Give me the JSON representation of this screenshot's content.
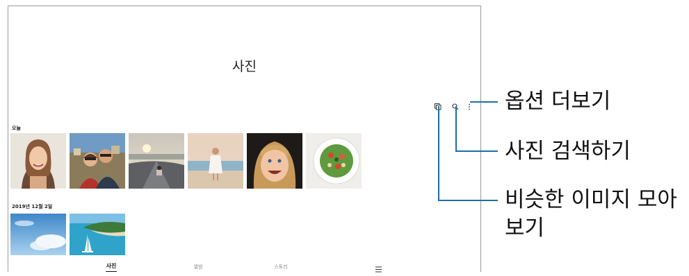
{
  "header": {
    "title": "사진"
  },
  "toolbar": {
    "similar_icon": "stack-icon",
    "search_icon": "search-icon",
    "more_icon": "more-vert-icon"
  },
  "sections": [
    {
      "label": "오늘"
    },
    {
      "label": "2019년 12월 2일"
    }
  ],
  "bottom_nav": {
    "items": [
      {
        "label": "사진",
        "active": true
      },
      {
        "label": "앨범",
        "active": false
      },
      {
        "label": "스토리",
        "active": false
      }
    ],
    "menu_icon": "hamburger-menu-icon"
  },
  "callouts": {
    "more_options": "옵션 더보기",
    "search": "사진 검색하기",
    "similar_line1": "비슷한 이미지 모아",
    "similar_line2": "보기"
  },
  "colors": {
    "leader_line": "#1b6ea8",
    "frame_border": "#9a9a9a"
  }
}
